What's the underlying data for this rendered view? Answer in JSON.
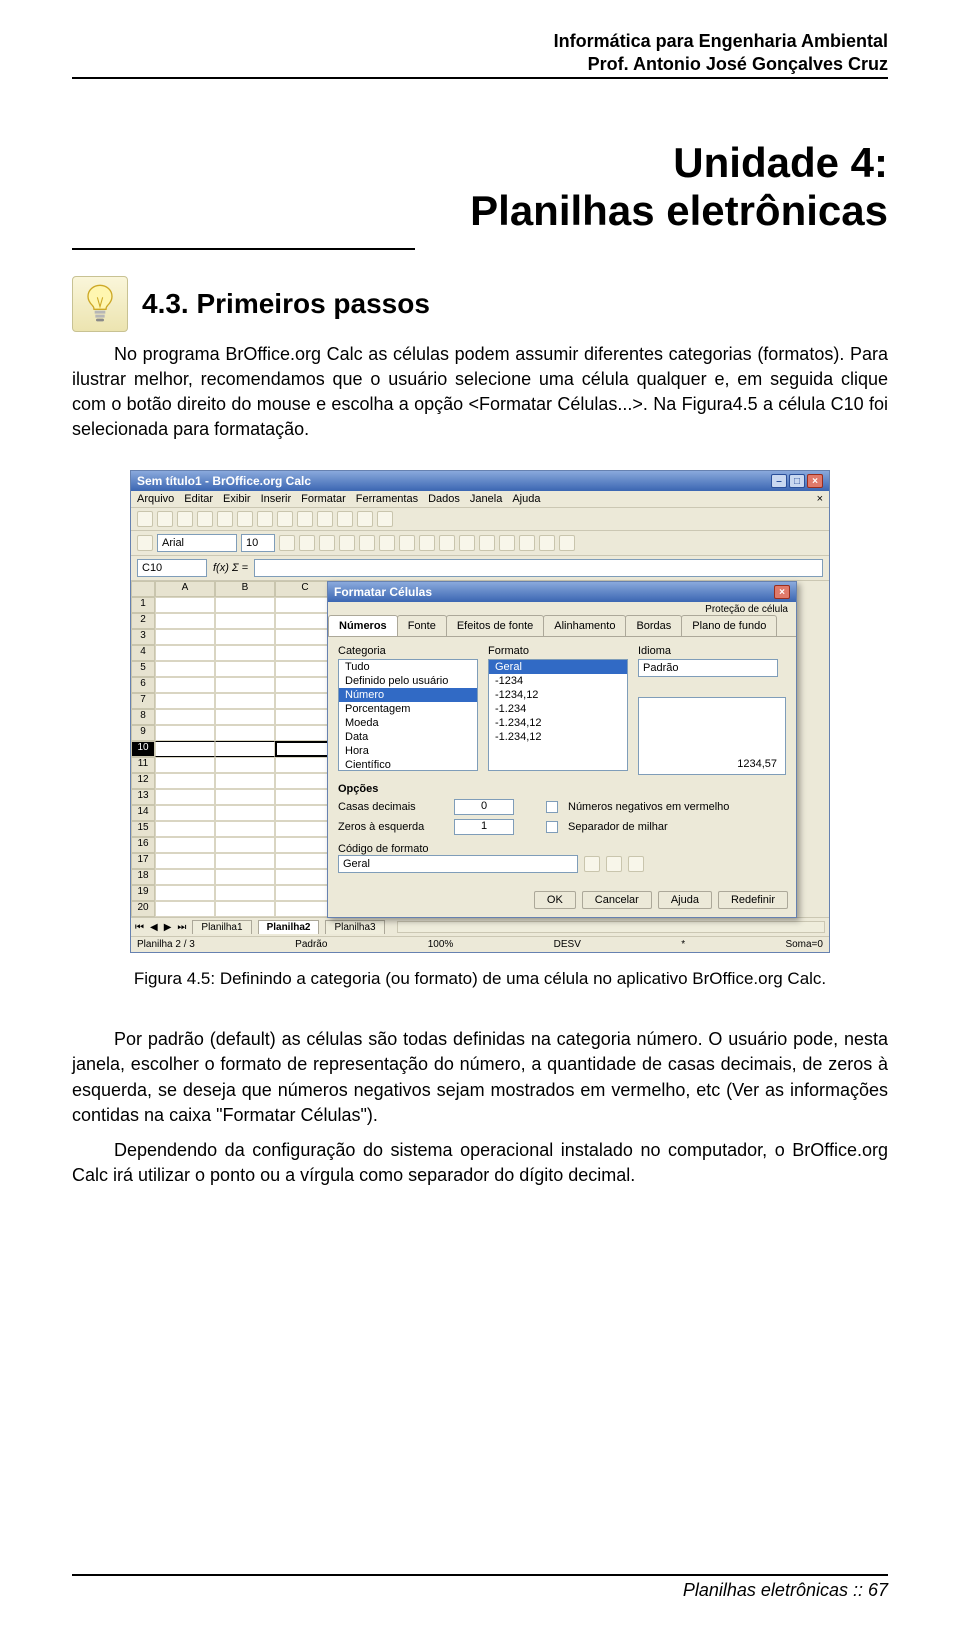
{
  "header": {
    "course": "Informática para Engenharia Ambiental",
    "prof": "Prof. Antonio José Gonçalves Cruz"
  },
  "title": {
    "line1": "Unidade 4:",
    "line2": "Planilhas eletrônicas"
  },
  "section_head": "4.3. Primeiros passos",
  "para1": "No programa BrOffice.org Calc as células podem assumir diferentes categorias (formatos). Para ilustrar melhor, recomendamos que o usuário selecione uma célula qualquer e, em seguida clique com o botão direito do mouse e escolha a opção <Formatar Células...>. Na Figura4.5 a célula C10 foi selecionada para formatação.",
  "caption": "Figura 4.5: Definindo a categoria (ou formato) de uma célula no aplicativo BrOffice.org Calc.",
  "para2": "Por padrão (default) as células são todas definidas na categoria número. O usuário pode, nesta janela, escolher o formato de representação do número, a quantidade de casas decimais, de zeros à esquerda, se deseja que números negativos sejam mostrados em vermelho, etc (Ver as informações contidas na caixa \"Formatar Células\").",
  "para3": "Dependendo da configuração do sistema operacional instalado no computador, o BrOffice.org Calc irá utilizar o ponto ou a vírgula como separador do dígito decimal.",
  "calc": {
    "wintitle": "Sem título1 - BrOffice.org Calc",
    "menus": [
      "Arquivo",
      "Editar",
      "Exibir",
      "Inserir",
      "Formatar",
      "Ferramentas",
      "Dados",
      "Janela",
      "Ajuda"
    ],
    "font": "Arial",
    "fontsize": "10",
    "cellref": "C10",
    "fx": "f(x)  Σ  =",
    "cols": [
      "A",
      "B",
      "C"
    ],
    "rows": [
      "1",
      "2",
      "3",
      "4",
      "5",
      "6",
      "7",
      "8",
      "9",
      "10",
      "11",
      "12",
      "13",
      "14",
      "15",
      "16",
      "17",
      "18",
      "19",
      "20"
    ],
    "sheets": {
      "items": [
        "Planilha1",
        "Planilha2",
        "Planilha3"
      ],
      "active": "Planilha2"
    },
    "status": {
      "sheet": "Planilha 2 / 3",
      "style": "Padrão",
      "zoom": "100%",
      "mode": "DESV",
      "sum": "Soma=0"
    }
  },
  "dialog": {
    "title": "Formatar Células",
    "tab_protect": "Proteção de célula",
    "tabs": [
      "Números",
      "Fonte",
      "Efeitos de fonte",
      "Alinhamento",
      "Bordas",
      "Plano de fundo"
    ],
    "categoria_label": "Categoria",
    "categorias": [
      "Tudo",
      "Definido pelo usuário",
      "Número",
      "Porcentagem",
      "Moeda",
      "Data",
      "Hora",
      "Científico"
    ],
    "categoria_sel": "Número",
    "formato_label": "Formato",
    "formatos": [
      "Geral",
      "-1234",
      "-1234,12",
      "-1.234",
      "-1.234,12",
      "-1.234,12"
    ],
    "formato_sel": "Geral",
    "idioma_label": "Idioma",
    "idioma_val": "Padrão",
    "preview": "1234,57",
    "opcoes_label": "Opções",
    "casas_label": "Casas decimais",
    "casas_val": "0",
    "zeros_label": "Zeros à esquerda",
    "zeros_val": "1",
    "neg_label": "Números negativos em vermelho",
    "sep_label": "Separador de milhar",
    "codigo_label": "Código de formato",
    "codigo_val": "Geral",
    "btns": [
      "OK",
      "Cancelar",
      "Ajuda",
      "Redefinir"
    ]
  },
  "footer": "Planilhas eletrônicas :: 67"
}
